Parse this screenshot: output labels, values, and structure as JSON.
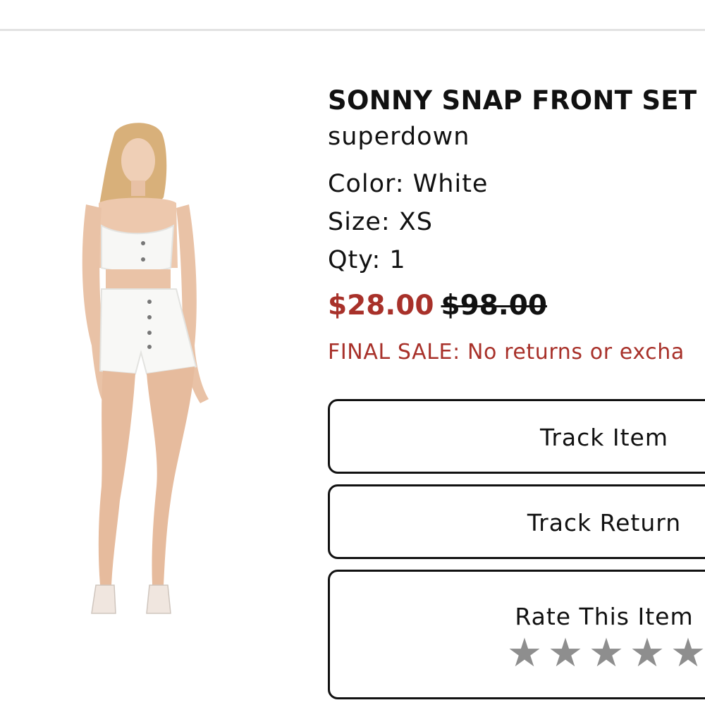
{
  "product": {
    "title": "SONNY SNAP FRONT SET",
    "brand": "superdown",
    "color_line": "Color: White",
    "size_line": "Size: XS",
    "qty_line": "Qty: 1",
    "sale_price": "$28.00",
    "original_price": "$98.00",
    "final_sale_notice": "FINAL SALE: No returns or excha",
    "image_icon": "product-photo-white-crop-top-shorts-set"
  },
  "actions": {
    "track_item_label": "Track Item",
    "track_return_label": "Track Return",
    "rate_label": "Rate This Item",
    "rating": {
      "stars": [
        "★",
        "★",
        "★",
        "★",
        "★"
      ],
      "selected": 0
    }
  },
  "colors": {
    "sale_red": "#a8312a",
    "star_gray": "#8e8e8e",
    "border": "#111111"
  }
}
